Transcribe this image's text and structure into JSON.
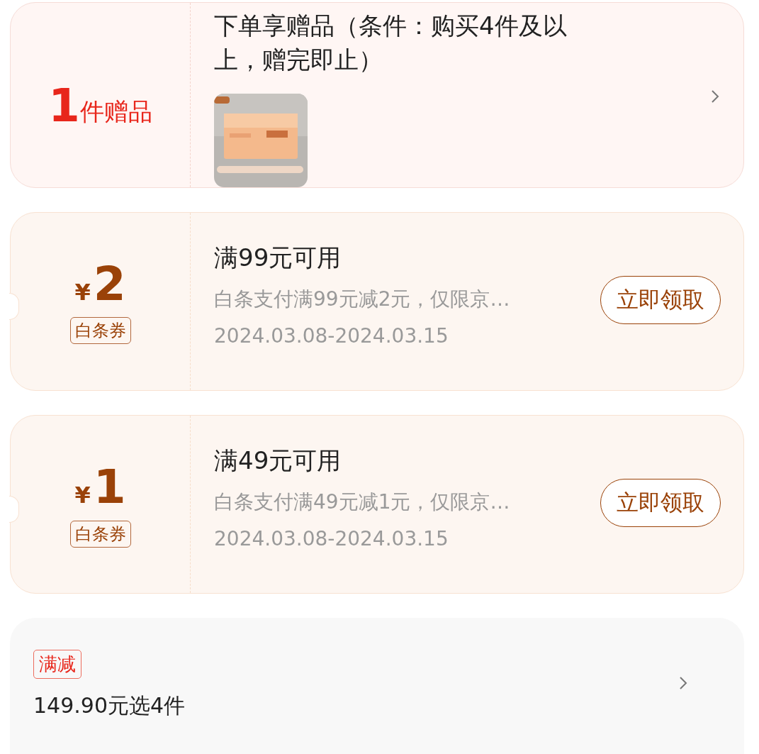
{
  "gift": {
    "count": "1",
    "count_unit": "件赠品",
    "title": "下单享赠品（条件：购买4件及以上，赠完即止）"
  },
  "coupons": [
    {
      "currency": "¥",
      "amount": "2",
      "tag": "白条券",
      "title": "满99元可用",
      "desc": "白条支付满99元减2元，仅限京…",
      "period": "2024.03.08-2024.03.15",
      "button": "立即领取"
    },
    {
      "currency": "¥",
      "amount": "1",
      "tag": "白条券",
      "title": "满49元可用",
      "desc": "白条支付满49元减1元，仅限京…",
      "period": "2024.03.08-2024.03.15",
      "button": "立即领取"
    }
  ],
  "promotion": {
    "tag": "满减",
    "text": "149.90元选4件"
  }
}
